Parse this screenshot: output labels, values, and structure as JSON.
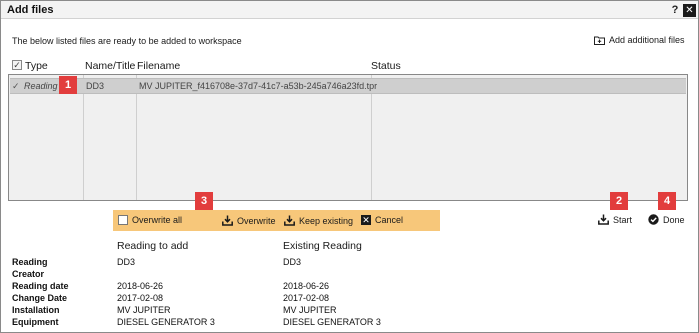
{
  "window": {
    "title": "Add files",
    "help_label": "?",
    "close_label": "✕"
  },
  "info_text": "The below listed files are ready to be added to workspace",
  "add_files_label": "Add additional files",
  "grid": {
    "columns": [
      "Type",
      "Name/Title",
      "Filename",
      "Status"
    ],
    "rows": [
      {
        "checked": true,
        "type": "Reading",
        "name": "DD3",
        "filename": "MV JUPITER_f416708e-37d7-41c7-a53b-245a746a23fd.tpr",
        "status": ""
      }
    ]
  },
  "badges": [
    "1",
    "2",
    "3",
    "4"
  ],
  "action_bar": {
    "overwrite_all_label": "Overwrite all",
    "overwrite_label": "Overwrite",
    "keep_existing_label": "Keep existing",
    "cancel_label": "Cancel",
    "background_color": "#f7c77a"
  },
  "start_label": "Start",
  "done_label": "Done",
  "comparison": {
    "headers": [
      "Reading to add",
      "Existing Reading"
    ],
    "rows": [
      {
        "label": "Reading",
        "to_add": "DD3",
        "existing": "DD3"
      },
      {
        "label": "Creator",
        "to_add": "",
        "existing": ""
      },
      {
        "label": "Reading date",
        "to_add": "2018-06-26",
        "existing": "2018-06-26"
      },
      {
        "label": "Change Date",
        "to_add": "2017-02-08",
        "existing": "2017-02-08"
      },
      {
        "label": "Installation",
        "to_add": "MV JUPITER",
        "existing": "MV JUPITER"
      },
      {
        "label": "Equipment",
        "to_add": "DIESEL GENERATOR 3",
        "existing": "DIESEL GENERATOR 3"
      }
    ]
  },
  "colors": {
    "badge": "#e23d3d",
    "selected_row": "#cfcfcf"
  }
}
